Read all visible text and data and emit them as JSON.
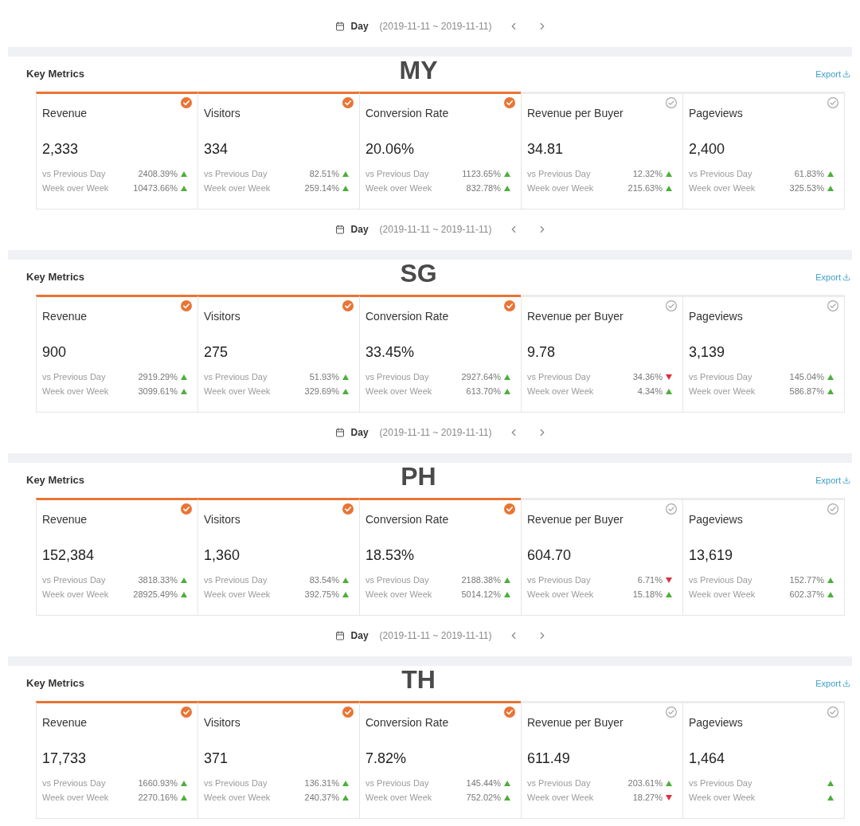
{
  "sections": [
    {
      "date_bar": {
        "period": "Day",
        "range": "(2019-11-11 ~ 2019-11-11)"
      },
      "panel": {
        "title": "Key Metrics",
        "country": "MY",
        "export": "Export"
      },
      "metrics": [
        {
          "name": "Revenue",
          "value": "2,333",
          "selected": true,
          "comparisons": [
            {
              "label": "vs Previous Day",
              "value": "2408.39%",
              "increase": true
            },
            {
              "label": "Week over Week",
              "value": "10473.66%",
              "increase": true
            }
          ]
        },
        {
          "name": "Visitors",
          "value": "334",
          "selected": true,
          "comparisons": [
            {
              "label": "vs Previous Day",
              "value": "82.51%",
              "increase": true
            },
            {
              "label": "Week over Week",
              "value": "259.14%",
              "increase": true
            }
          ]
        },
        {
          "name": "Conversion Rate",
          "value": "20.06%",
          "selected": true,
          "comparisons": [
            {
              "label": "vs Previous Day",
              "value": "1123.65%",
              "increase": true
            },
            {
              "label": "Week over Week",
              "value": "832.78%",
              "increase": true
            }
          ]
        },
        {
          "name": "Revenue per Buyer",
          "value": "34.81",
          "selected": false,
          "comparisons": [
            {
              "label": "vs Previous Day",
              "value": "12.32%",
              "increase": true
            },
            {
              "label": "Week over Week",
              "value": "215.63%",
              "increase": true
            }
          ]
        },
        {
          "name": "Pageviews",
          "value": "2,400",
          "selected": false,
          "comparisons": [
            {
              "label": "vs Previous Day",
              "value": "61.83%",
              "increase": true
            },
            {
              "label": "Week over Week",
              "value": "325.53%",
              "increase": true
            }
          ]
        }
      ]
    },
    {
      "date_bar": {
        "period": "Day",
        "range": "(2019-11-11 ~ 2019-11-11)"
      },
      "panel": {
        "title": "Key Metrics",
        "country": "SG",
        "export": "Export"
      },
      "metrics": [
        {
          "name": "Revenue",
          "value": "900",
          "selected": true,
          "comparisons": [
            {
              "label": "vs Previous Day",
              "value": "2919.29%",
              "increase": true
            },
            {
              "label": "Week over Week",
              "value": "3099.61%",
              "increase": true
            }
          ]
        },
        {
          "name": "Visitors",
          "value": "275",
          "selected": true,
          "comparisons": [
            {
              "label": "vs Previous Day",
              "value": "51.93%",
              "increase": true
            },
            {
              "label": "Week over Week",
              "value": "329.69%",
              "increase": true
            }
          ]
        },
        {
          "name": "Conversion Rate",
          "value": "33.45%",
          "selected": true,
          "comparisons": [
            {
              "label": "vs Previous Day",
              "value": "2927.64%",
              "increase": true
            },
            {
              "label": "Week over Week",
              "value": "613.70%",
              "increase": true
            }
          ]
        },
        {
          "name": "Revenue per Buyer",
          "value": "9.78",
          "selected": false,
          "comparisons": [
            {
              "label": "vs Previous Day",
              "value": "34.36%",
              "increase": false
            },
            {
              "label": "Week over Week",
              "value": "4.34%",
              "increase": true
            }
          ]
        },
        {
          "name": "Pageviews",
          "value": "3,139",
          "selected": false,
          "comparisons": [
            {
              "label": "vs Previous Day",
              "value": "145.04%",
              "increase": true
            },
            {
              "label": "Week over Week",
              "value": "586.87%",
              "increase": true
            }
          ]
        }
      ]
    },
    {
      "date_bar": {
        "period": "Day",
        "range": "(2019-11-11 ~ 2019-11-11)"
      },
      "panel": {
        "title": "Key Metrics",
        "country": "PH",
        "export": "Export"
      },
      "metrics": [
        {
          "name": "Revenue",
          "value": "152,384",
          "selected": true,
          "comparisons": [
            {
              "label": "vs Previous Day",
              "value": "3818.33%",
              "increase": true
            },
            {
              "label": "Week over Week",
              "value": "28925.49%",
              "increase": true
            }
          ]
        },
        {
          "name": "Visitors",
          "value": "1,360",
          "selected": true,
          "comparisons": [
            {
              "label": "vs Previous Day",
              "value": "83.54%",
              "increase": true
            },
            {
              "label": "Week over Week",
              "value": "392.75%",
              "increase": true
            }
          ]
        },
        {
          "name": "Conversion Rate",
          "value": "18.53%",
          "selected": true,
          "comparisons": [
            {
              "label": "vs Previous Day",
              "value": "2188.38%",
              "increase": true
            },
            {
              "label": "Week over Week",
              "value": "5014.12%",
              "increase": true
            }
          ]
        },
        {
          "name": "Revenue per Buyer",
          "value": "604.70",
          "selected": false,
          "comparisons": [
            {
              "label": "vs Previous Day",
              "value": "6.71%",
              "increase": false
            },
            {
              "label": "Week over Week",
              "value": "15.18%",
              "increase": true
            }
          ]
        },
        {
          "name": "Pageviews",
          "value": "13,619",
          "selected": false,
          "comparisons": [
            {
              "label": "vs Previous Day",
              "value": "152.77%",
              "increase": true
            },
            {
              "label": "Week over Week",
              "value": "602.37%",
              "increase": true
            }
          ]
        }
      ]
    },
    {
      "date_bar": {
        "period": "Day",
        "range": "(2019-11-11 ~ 2019-11-11)"
      },
      "panel": {
        "title": "Key Metrics",
        "country": "TH",
        "export": "Export"
      },
      "metrics": [
        {
          "name": "Revenue",
          "value": "17,733",
          "selected": true,
          "comparisons": [
            {
              "label": "vs Previous Day",
              "value": "1660.93%",
              "increase": true
            },
            {
              "label": "Week over Week",
              "value": "2270.16%",
              "increase": true
            }
          ]
        },
        {
          "name": "Visitors",
          "value": "371",
          "selected": true,
          "comparisons": [
            {
              "label": "vs Previous Day",
              "value": "136.31%",
              "increase": true
            },
            {
              "label": "Week over Week",
              "value": "240.37%",
              "increase": true
            }
          ]
        },
        {
          "name": "Conversion Rate",
          "value": "7.82%",
          "selected": true,
          "comparisons": [
            {
              "label": "vs Previous Day",
              "value": "145.44%",
              "increase": true
            },
            {
              "label": "Week over Week",
              "value": "752.02%",
              "increase": true
            }
          ]
        },
        {
          "name": "Revenue per Buyer",
          "value": "611.49",
          "selected": false,
          "comparisons": [
            {
              "label": "vs Previous Day",
              "value": "203.61%",
              "increase": true
            },
            {
              "label": "Week over Week",
              "value": "18.27%",
              "increase": false
            }
          ]
        },
        {
          "name": "Pageviews",
          "value": "1,464",
          "selected": false,
          "comparisons": [
            {
              "label": "vs Previous Day",
              "increase": true
            },
            {
              "label": "Week over Week",
              "increase": true
            }
          ]
        }
      ]
    }
  ]
}
